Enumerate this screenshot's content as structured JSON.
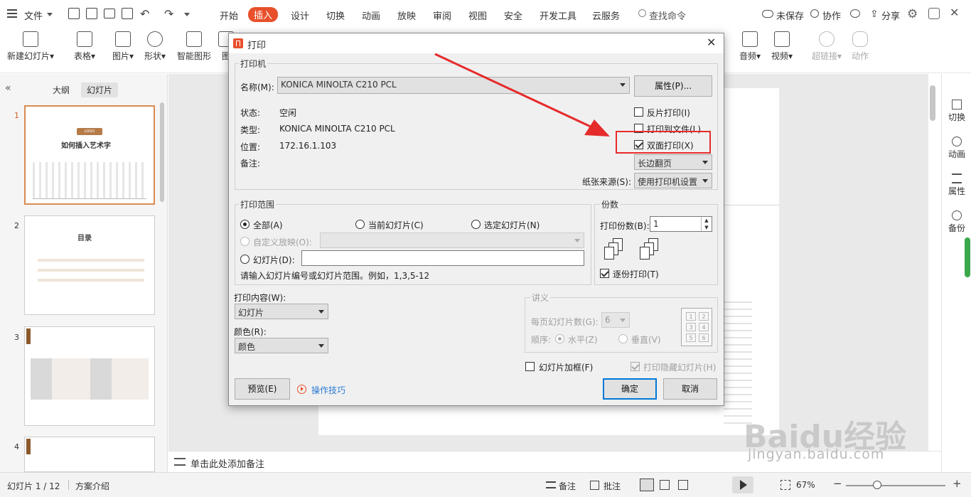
{
  "menubar": {
    "file": "文件",
    "tabs": [
      "开始",
      "插入",
      "设计",
      "切换",
      "动画",
      "放映",
      "审阅",
      "视图",
      "安全",
      "开发工具",
      "云服务"
    ],
    "search": "查找命令",
    "unsaved": "未保存",
    "collab": "协作",
    "share": "分享"
  },
  "ribbon": {
    "new_slide": "新建幻灯片",
    "table": "表格",
    "picture": "图片",
    "shape": "形状",
    "smartart": "智能图形",
    "chart_partial": "图",
    "audio": "音频",
    "video": "视频",
    "hyperlink": "超链接",
    "action": "动作"
  },
  "leftpane": {
    "tab_outline": "大纲",
    "tab_slides": "幻灯片",
    "slides": [
      {
        "num": "1",
        "title": "如何插入艺术字",
        "badge": "LOGO"
      },
      {
        "num": "2",
        "title": "目录"
      },
      {
        "num": "3"
      },
      {
        "num": "4"
      }
    ]
  },
  "rightbar": {
    "switch": "切换",
    "animation": "动画",
    "property": "属性",
    "backup": "备份"
  },
  "notes": {
    "placeholder": "单击此处添加备注"
  },
  "statusbar": {
    "slide_pos": "幻灯片 1 / 12",
    "scheme": "方案介绍",
    "notes": "备注",
    "comment": "批注",
    "zoom": "67%"
  },
  "dialog": {
    "title": "打印",
    "printer_group": "打印机",
    "name_label": "名称(M):",
    "printer_name": "KONICA MINOLTA C210 PCL",
    "properties_btn": "属性(P)...",
    "status_label": "状态:",
    "status_value": "空闲",
    "type_label": "类型:",
    "type_value": "KONICA MINOLTA C210 PCL",
    "location_label": "位置:",
    "location_value": "172.16.1.103",
    "comment_label": "备注:",
    "reverse_print": "反片打印(I)",
    "print_to_file": "打印到文件(L)",
    "duplex": "双面打印(X)",
    "flip_value": "长边翻页",
    "paper_source_label": "纸张来源(S):",
    "paper_source_value": "使用打印机设置",
    "range_group": "打印范围",
    "range_all": "全部(A)",
    "range_current": "当前幻灯片(C)",
    "range_selected": "选定幻灯片(N)",
    "range_custom": "自定义放映(O):",
    "range_slides": "幻灯片(D):",
    "range_hint": "请输入幻灯片编号或幻灯片范围。例如，1,3,5-12",
    "copies_group": "份数",
    "copies_label": "打印份数(B):",
    "copies_value": "1",
    "collate": "逐份打印(T)",
    "content_label": "打印内容(W):",
    "content_value": "幻灯片",
    "color_label": "颜色(R):",
    "color_value": "颜色",
    "handout_group": "讲义",
    "per_page_label": "每页幻灯片数(G):",
    "per_page_value": "6",
    "order_label": "顺序:",
    "order_horizontal": "水平(Z)",
    "order_vertical": "垂直(V)",
    "frame": "幻灯片加框(F)",
    "print_hidden": "打印隐藏幻灯片(H)",
    "preview_btn": "预览(E)",
    "tips": "操作技巧",
    "ok": "确定",
    "cancel": "取消"
  },
  "watermark": {
    "brand": "Baidu经验",
    "url": "jingyan.baidu.com"
  },
  "colors": {
    "accent": "#e8502b",
    "annotation": "#e62b2b",
    "focus": "#0078d7"
  }
}
